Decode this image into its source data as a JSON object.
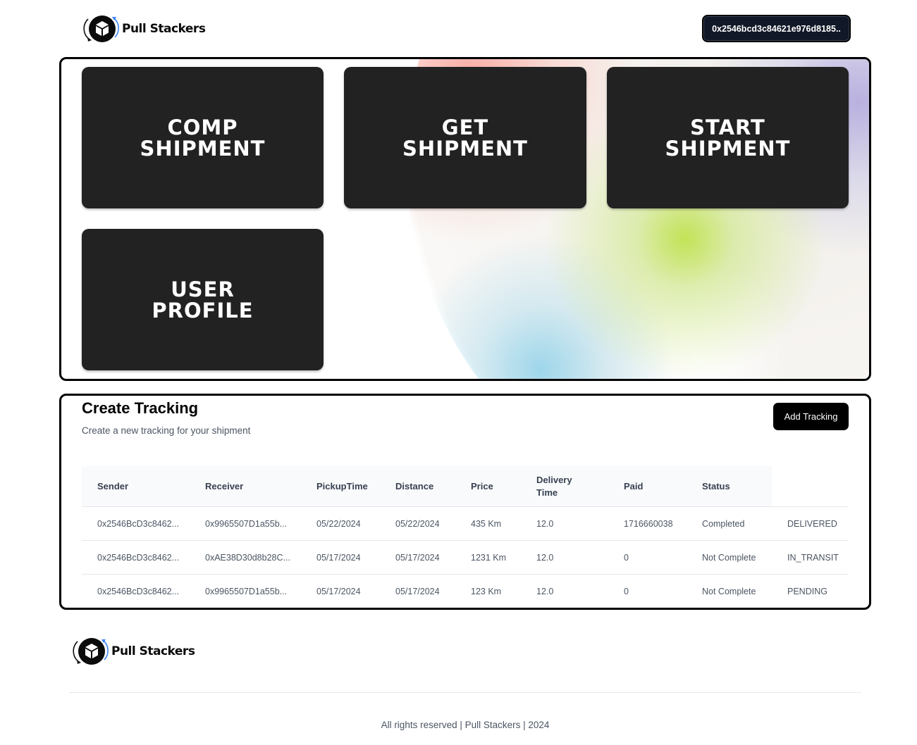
{
  "brand": {
    "name": "Pull Stackers",
    "logo_icon": "box-cycle-icon"
  },
  "header": {
    "wallet_address": "0x2546bcd3c84621e976d8185.."
  },
  "hero": {
    "cards": [
      {
        "line1": "COMP",
        "line2": "SHIPMENT"
      },
      {
        "line1": "GET",
        "line2": "SHIPMENT"
      },
      {
        "line1": "START",
        "line2": "SHIPMENT"
      },
      {
        "line1": "USER",
        "line2": "PROFILE"
      }
    ]
  },
  "tracking": {
    "title": "Create Tracking",
    "subtitle": "Create a new tracking for your shipment",
    "add_button": "Add Tracking",
    "columns": [
      "Sender",
      "Receiver",
      "PickupTime",
      "Distance",
      "Price",
      "Delivery Time",
      "Paid",
      "Status"
    ],
    "delivery_time_line1": "Delivery",
    "delivery_time_line2": "Time",
    "rows": [
      [
        "0x2546BcD3c8462...",
        "0x9965507D1a55b...",
        "05/22/2024",
        "05/22/2024",
        "435 Km",
        "12.0",
        "1716660038",
        "Completed",
        "DELIVERED"
      ],
      [
        "0x2546BcD3c8462...",
        "0xAE38D30d8b28C...",
        "05/17/2024",
        "05/17/2024",
        "1231 Km",
        "12.0",
        "0",
        "Not Complete",
        "IN_TRANSIT"
      ],
      [
        "0x2546BcD3c8462...",
        "0x9965507D1a55b...",
        "05/17/2024",
        "05/17/2024",
        "123 Km",
        "12.0",
        "0",
        "Not Complete",
        "PENDING"
      ]
    ]
  },
  "footer": {
    "copyright": "All rights reserved | Pull Stackers | 2024"
  },
  "colors": {
    "card_bg": "#222222",
    "wallet_bg": "#111827",
    "button_bg": "#000000"
  }
}
